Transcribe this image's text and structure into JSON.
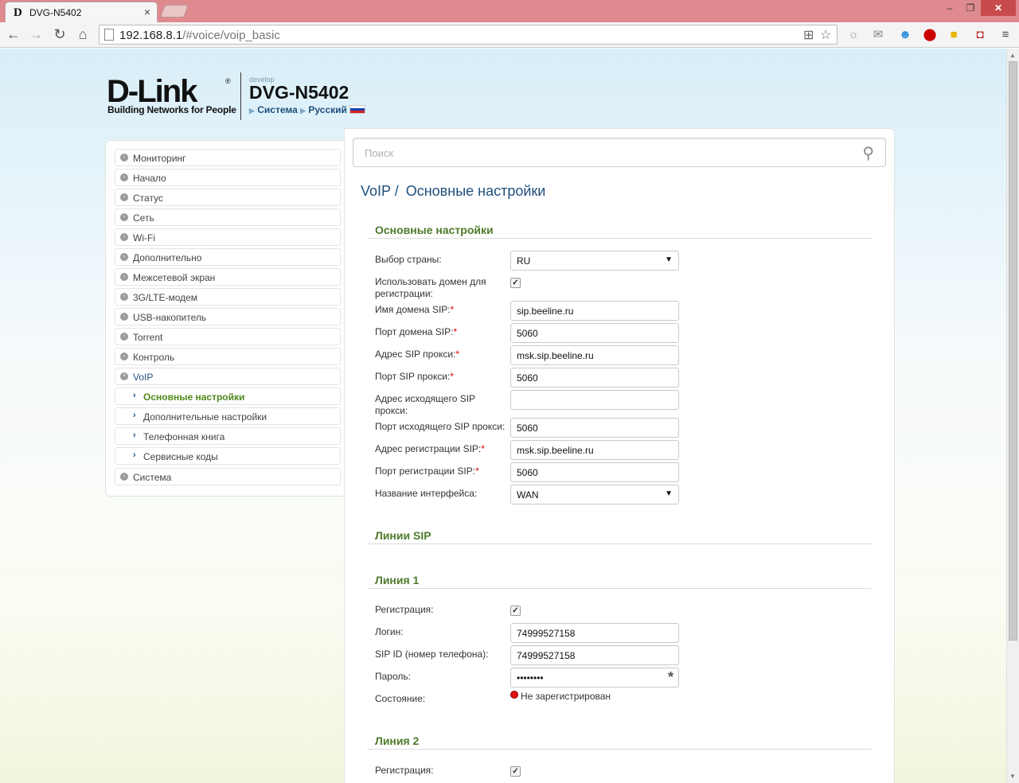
{
  "browser": {
    "tab_title": "DVG-N5402",
    "tab_favicon": "D",
    "url_host": "192.168.8.1",
    "url_path": "/#voice/voip_basic"
  },
  "header": {
    "logo": "D-Link",
    "logo_reg": "®",
    "tagline": "Building Networks for People",
    "develop": "develop",
    "model": "DVG-N5402",
    "link_system": "Система",
    "link_language": "Русский"
  },
  "sidebar": {
    "items": [
      {
        "label": "Мониторинг"
      },
      {
        "label": "Начало"
      },
      {
        "label": "Статус"
      },
      {
        "label": "Сеть"
      },
      {
        "label": "Wi-Fi"
      },
      {
        "label": "Дополнительно"
      },
      {
        "label": "Межсетевой экран"
      },
      {
        "label": "3G/LTE-модем"
      },
      {
        "label": "USB-накопитель"
      },
      {
        "label": "Torrent"
      },
      {
        "label": "Контроль"
      },
      {
        "label": "VoIP"
      },
      {
        "label": "Основные настройки"
      },
      {
        "label": "Дополнительные настройки"
      },
      {
        "label": "Телефонная книга"
      },
      {
        "label": "Сервисные коды"
      },
      {
        "label": "Система"
      }
    ]
  },
  "search": {
    "placeholder": "Поиск"
  },
  "breadcrumb": {
    "parent": "VoIP /",
    "current": "Основные настройки"
  },
  "basic": {
    "title": "Основные настройки",
    "country_label": "Выбор страны:",
    "country_value": "RU",
    "use_domain_label": "Использовать домен для регистрации:",
    "sip_domain_label": "Имя домена SIP:",
    "sip_domain_value": "sip.beeline.ru",
    "sip_domain_port_label": "Порт домена SIP:",
    "sip_domain_port_value": "5060",
    "sip_proxy_label": "Адрес SIP прокси:",
    "sip_proxy_value": "msk.sip.beeline.ru",
    "sip_proxy_port_label": "Порт SIP прокси:",
    "sip_proxy_port_value": "5060",
    "outbound_proxy_label": "Адрес исходящего SIP прокси:",
    "outbound_proxy_value": "",
    "outbound_port_label": "Порт исходящего SIP прокси:",
    "outbound_port_value": "5060",
    "reg_addr_label": "Адрес регистрации SIP:",
    "reg_addr_value": "msk.sip.beeline.ru",
    "reg_port_label": "Порт регистрации SIP:",
    "reg_port_value": "5060",
    "iface_label": "Название интерфейса:",
    "iface_value": "WAN",
    "required_mark": "*"
  },
  "sip_lines": {
    "title": "Линии SIP"
  },
  "line1": {
    "title": "Линия 1",
    "registration_label": "Регистрация:",
    "login_label": "Логин:",
    "login_value": "74999527158",
    "sipid_label": "SIP ID (номер телефона):",
    "sipid_value": "74999527158",
    "password_label": "Пароль:",
    "password_value": "••••••••",
    "state_label": "Состояние:",
    "state_value": "Не зарегистрирован"
  },
  "line2": {
    "title": "Линия 2",
    "registration_label": "Регистрация:"
  },
  "colors": {
    "accent_blue": "#1f4f7d",
    "section_green": "#4e7a2a",
    "status_red": "#e01010"
  }
}
